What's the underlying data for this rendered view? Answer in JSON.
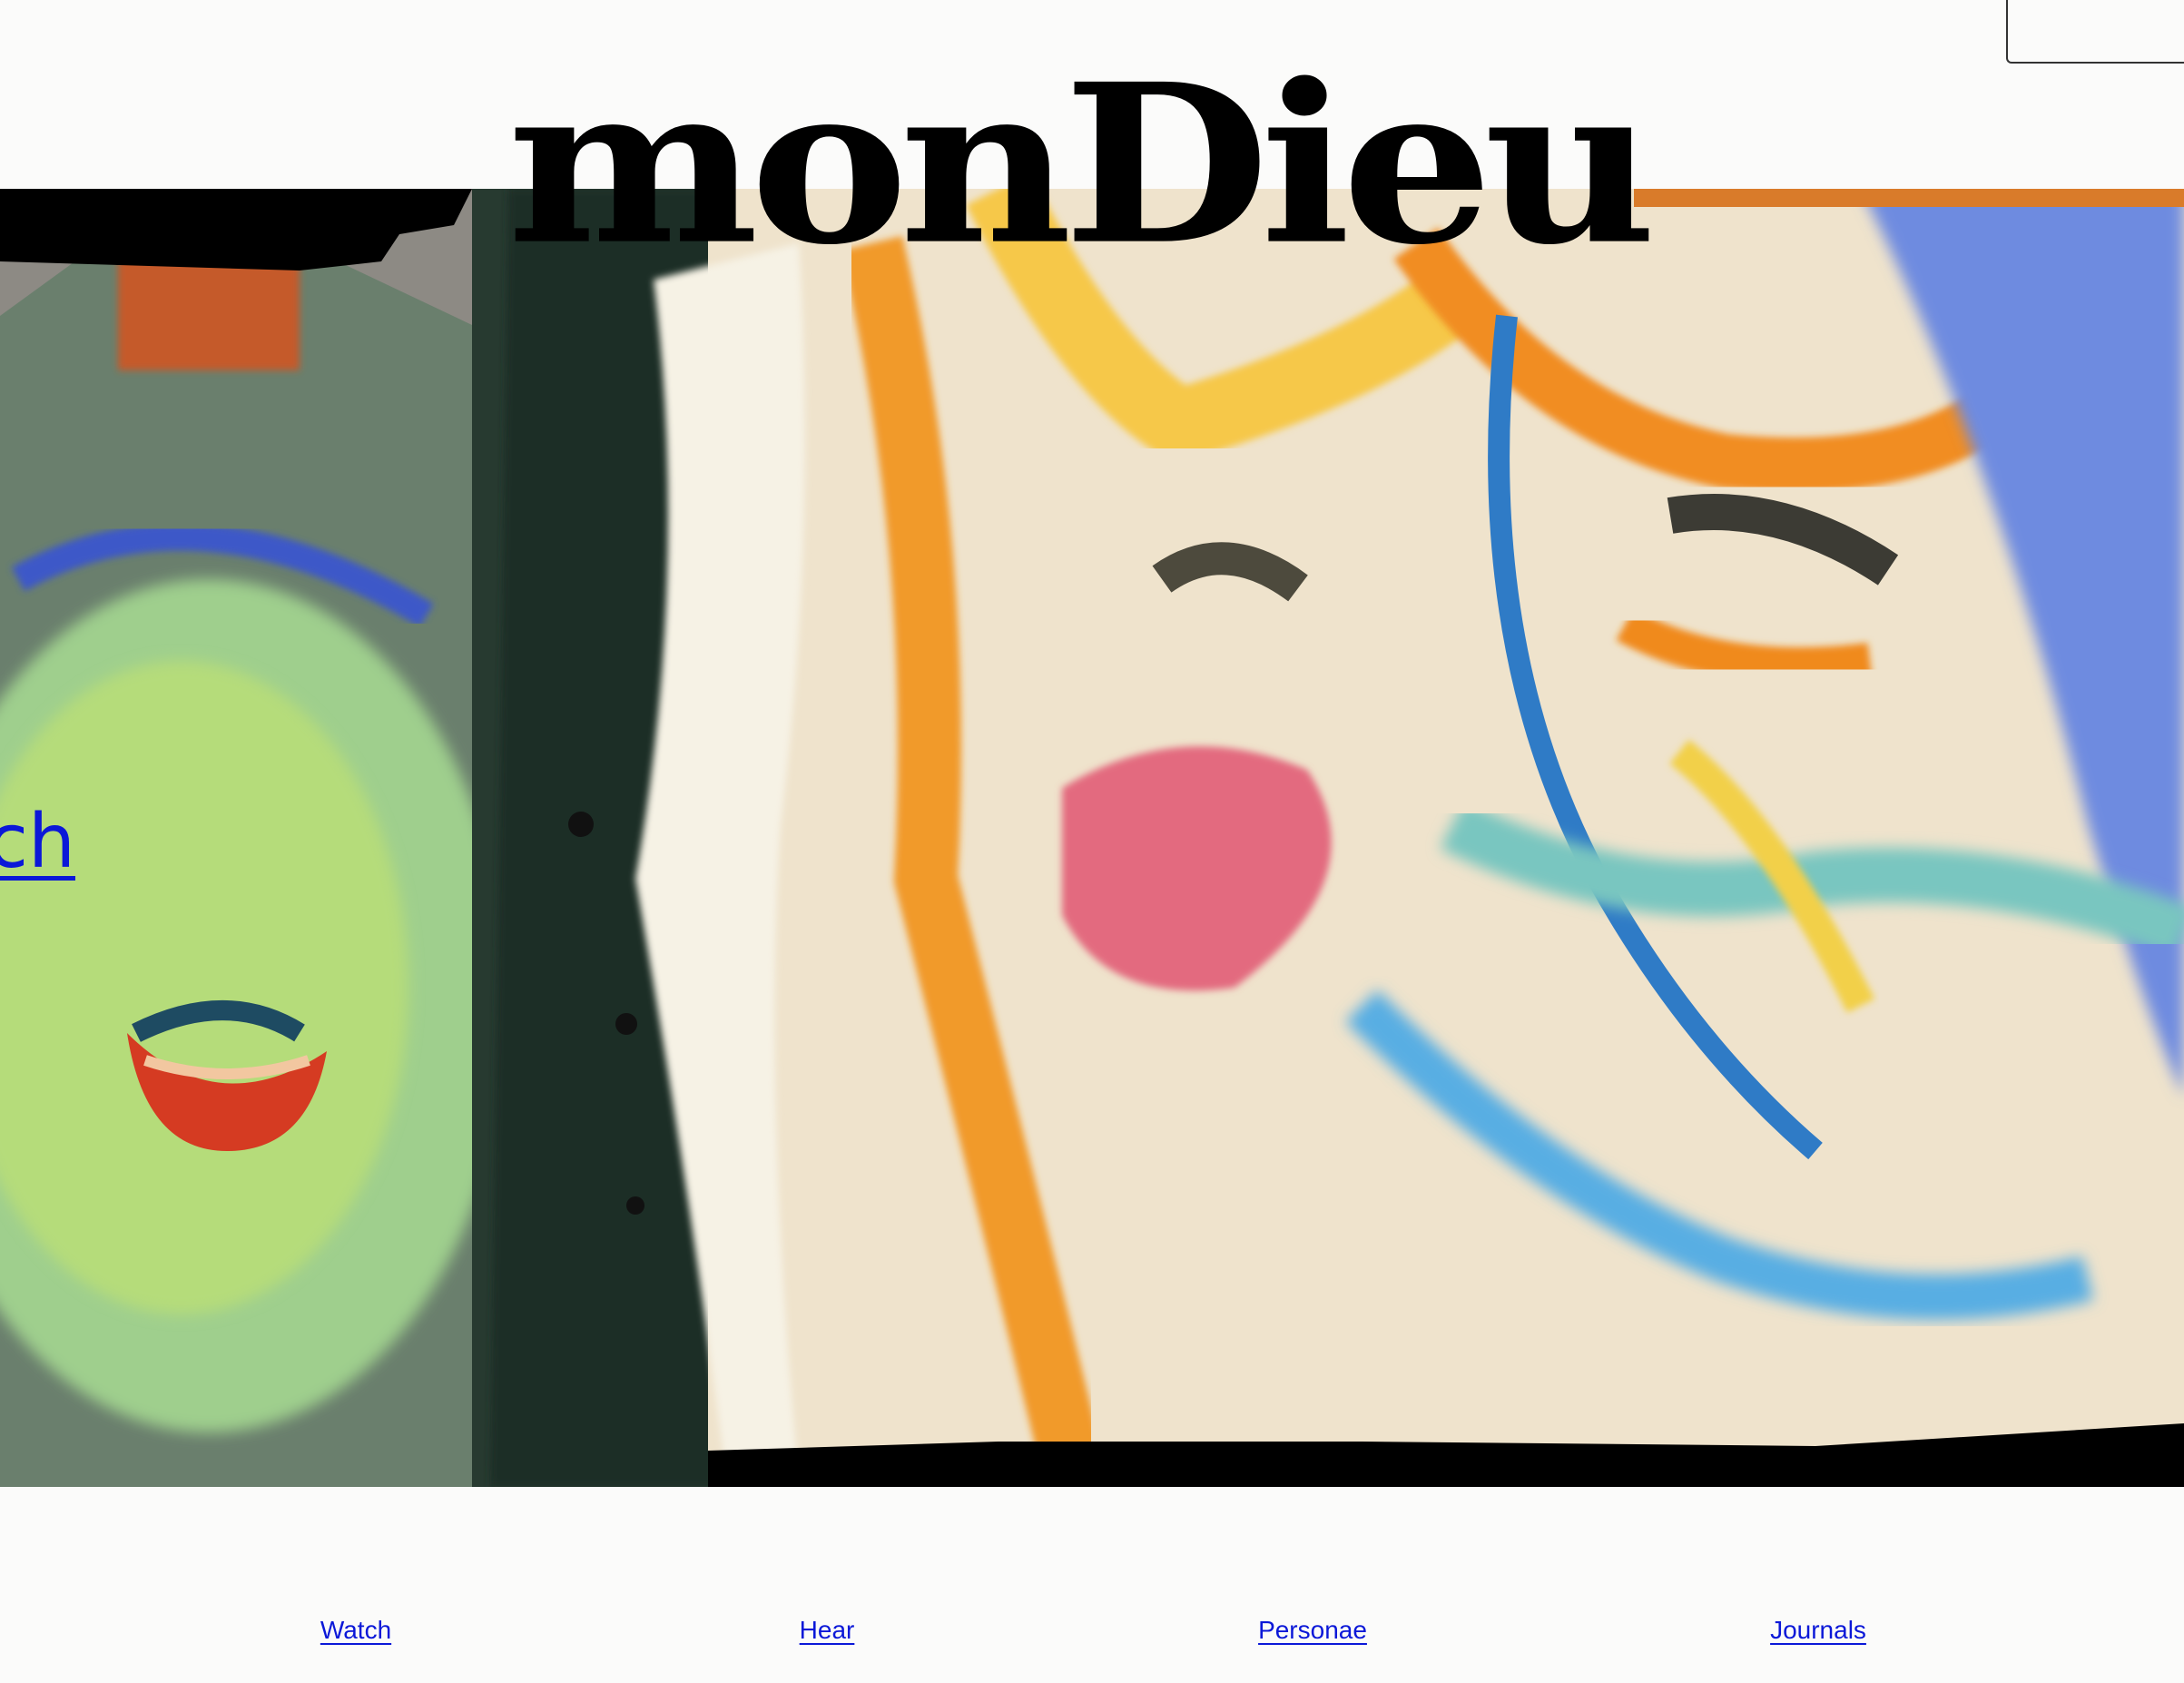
{
  "brand": {
    "logo_text": "monDieu"
  },
  "banner": {
    "image_icon": "painting-banner-image",
    "overlay_link_label": "unch"
  },
  "nav": {
    "items": [
      {
        "label": "Watch"
      },
      {
        "label": "Hear"
      },
      {
        "label": "Personae"
      },
      {
        "label": "Journals"
      }
    ]
  },
  "colors": {
    "link": "#0b18d8",
    "background": "#fbfbfa",
    "logo": "#000000"
  }
}
